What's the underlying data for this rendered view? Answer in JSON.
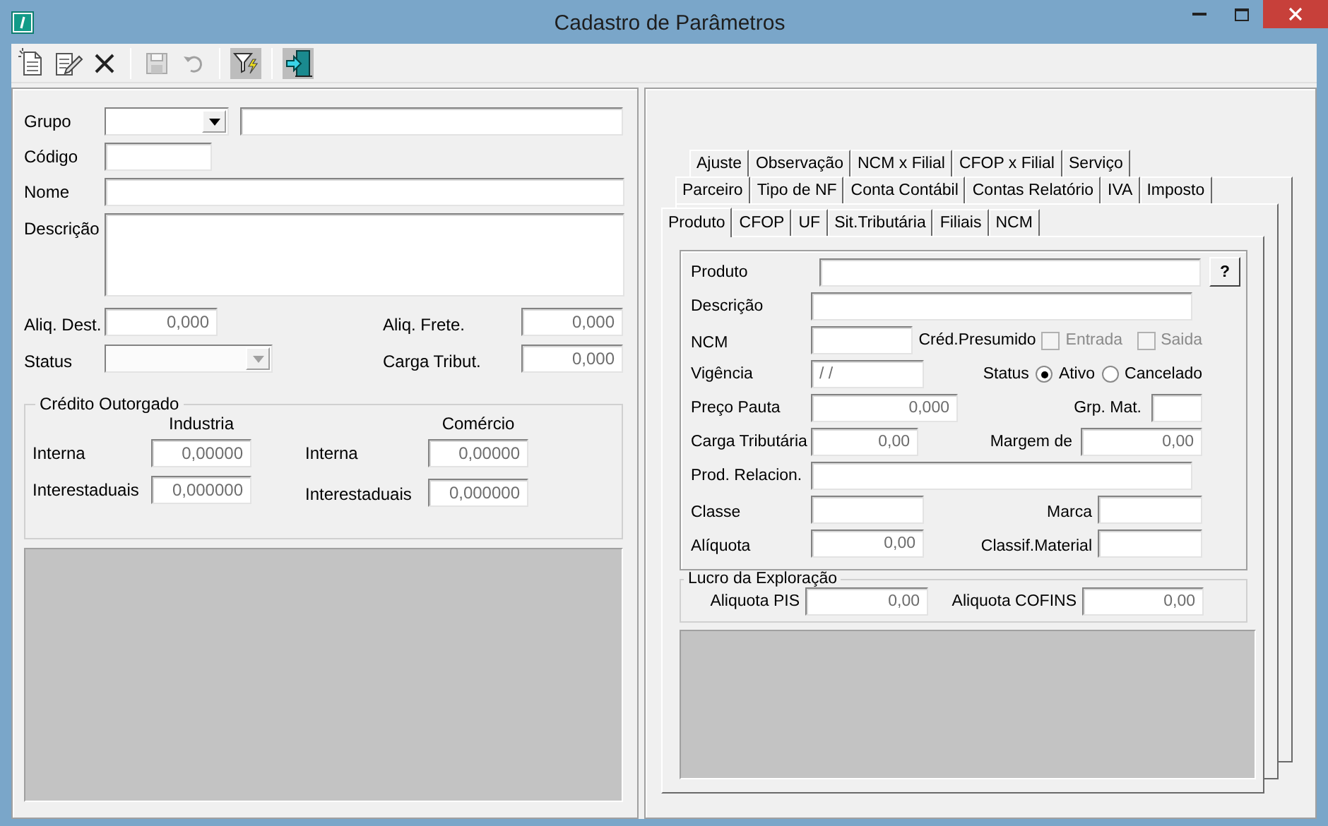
{
  "window": {
    "title": "Cadastro de Parâmetros"
  },
  "toolbar": [
    {
      "kind": "new",
      "disabled": false,
      "pressed": false
    },
    {
      "kind": "edit",
      "disabled": false,
      "pressed": false
    },
    {
      "kind": "delete",
      "disabled": false,
      "pressed": false
    },
    {
      "kind": "separator"
    },
    {
      "kind": "save",
      "disabled": true,
      "pressed": false
    },
    {
      "kind": "undo",
      "disabled": true,
      "pressed": false
    },
    {
      "kind": "separator"
    },
    {
      "kind": "filter",
      "disabled": false,
      "pressed": true
    },
    {
      "kind": "separator"
    },
    {
      "kind": "exit",
      "disabled": false,
      "pressed": true
    }
  ],
  "left": {
    "grupo": {
      "label": "Grupo"
    },
    "codigo": {
      "label": "Código"
    },
    "nome": {
      "label": "Nome"
    },
    "descricao": {
      "label": "Descrição"
    },
    "aliq_dest": {
      "label": "Aliq. Dest.",
      "value": "0,000"
    },
    "aliq_frete": {
      "label": "Aliq. Frete.",
      "value": "0,000"
    },
    "status": {
      "label": "Status",
      "disabled": true
    },
    "carga_tribut": {
      "label": "Carga Tribut.",
      "value": "0,000"
    },
    "credito_outorgado": {
      "title": "Crédito Outorgado",
      "columns": [
        {
          "heading": "Industria",
          "rows": [
            {
              "label": "Interna",
              "value": "0,00000"
            },
            {
              "label": "Interestaduais",
              "value": "0,000000"
            }
          ]
        },
        {
          "heading": "Comércio",
          "rows": [
            {
              "label": "Interna",
              "value": "0,00000"
            },
            {
              "label": "Interestaduais",
              "value": "0,000000"
            }
          ]
        }
      ]
    }
  },
  "tab_rows": [
    [
      {
        "label": "Ajuste",
        "selected": false
      },
      {
        "label": "Observação",
        "selected": false
      },
      {
        "label": "NCM x Filial",
        "selected": false
      },
      {
        "label": "CFOP x Filial",
        "selected": false
      },
      {
        "label": "Serviço",
        "selected": false
      }
    ],
    [
      {
        "label": "Parceiro",
        "selected": false
      },
      {
        "label": "Tipo de NF",
        "selected": false
      },
      {
        "label": "Conta Contábil",
        "selected": false
      },
      {
        "label": "Contas Relatório",
        "selected": false
      },
      {
        "label": "IVA",
        "selected": false
      },
      {
        "label": "Imposto",
        "selected": false
      }
    ],
    [
      {
        "label": "Produto",
        "selected": true
      },
      {
        "label": "CFOP",
        "selected": false
      },
      {
        "label": "UF",
        "selected": false
      },
      {
        "label": "Sit.Tributária",
        "selected": false
      },
      {
        "label": "Filiais",
        "selected": false
      },
      {
        "label": "NCM",
        "selected": false
      }
    ]
  ],
  "produto": {
    "produto": {
      "label": "Produto"
    },
    "help_button": "?",
    "descricao": {
      "label": "Descrição"
    },
    "ncm": {
      "label": "NCM"
    },
    "cred_presumido": {
      "label": "Créd.Presumido",
      "options": [
        {
          "label": "Entrada",
          "checked": false,
          "disabled": true
        },
        {
          "label": "Saida",
          "checked": false,
          "disabled": true
        }
      ]
    },
    "vigencia": {
      "label": "Vigência",
      "value": "/ /"
    },
    "status": {
      "label": "Status",
      "options": [
        {
          "label": "Ativo",
          "selected": true
        },
        {
          "label": "Cancelado",
          "selected": false
        }
      ]
    },
    "preco_pauta": {
      "label": "Preço Pauta",
      "value": "0,000"
    },
    "grp_mat": {
      "label": "Grp. Mat."
    },
    "carga_tributaria": {
      "label": "Carga Tributária",
      "value": "0,00"
    },
    "margem_de": {
      "label": "Margem de",
      "value": "0,00"
    },
    "prod_relacion": {
      "label": "Prod. Relacion."
    },
    "classe": {
      "label": "Classe"
    },
    "marca": {
      "label": "Marca"
    },
    "aliquota": {
      "label": "Alíquota",
      "value": "0,00"
    },
    "classif_material": {
      "label": "Classif.Material"
    }
  },
  "lucro": {
    "title": "Lucro da Exploração",
    "pis": {
      "label": "Aliquota PIS",
      "value": "0,00"
    },
    "cofins": {
      "label": "Aliquota COFINS",
      "value": "0,00"
    }
  }
}
